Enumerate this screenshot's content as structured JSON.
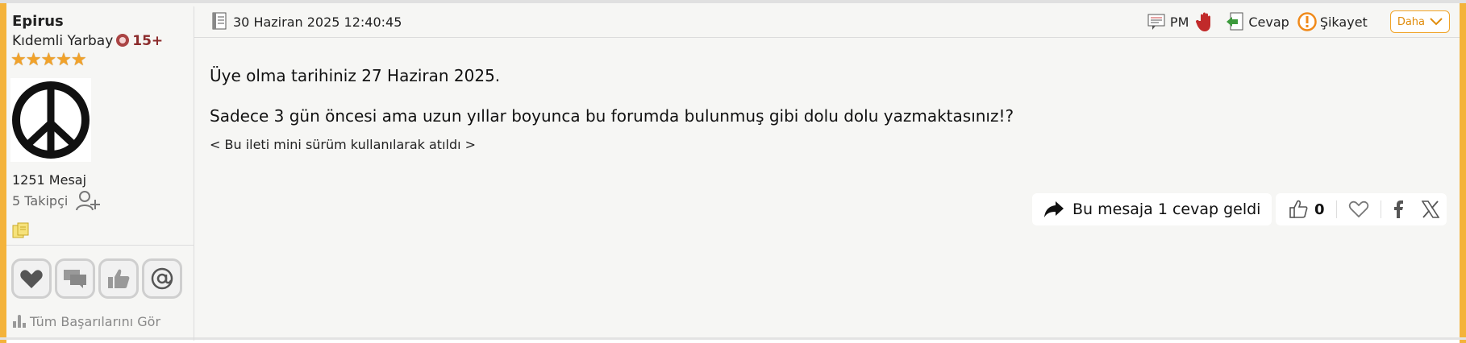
{
  "user": {
    "name": "Epirus",
    "rank": "Kıdemli Yarbay",
    "rank_level": "15+",
    "stars": "★★★★★",
    "messages": "1251 Mesaj",
    "followers": "5 Takipçi",
    "achievements_link": "Tüm Başarılarını Gör"
  },
  "post": {
    "date": "30 Haziran 2025 12:40:45",
    "body": {
      "line1": "Üye olma tarihiniz 27 Haziran 2025.",
      "line2": "Sadece 3 gün öncesi ama uzun yıllar boyunca bu forumda bulunmuş gibi dolu dolu yazmaktasınız!?",
      "line3": "< Bu ileti mini sürüm kullanılarak atıldı >"
    }
  },
  "actions": {
    "pm": "PM",
    "reply": "Cevap",
    "report": "Şikayet",
    "more": "Daha"
  },
  "footer": {
    "replies_text": "Bu mesaja 1 cevap geldi",
    "like_count": "0"
  },
  "colors": {
    "accent": "#f4b33a",
    "more_button": "#e08c0b",
    "rank_level": "#8b2b2b"
  }
}
